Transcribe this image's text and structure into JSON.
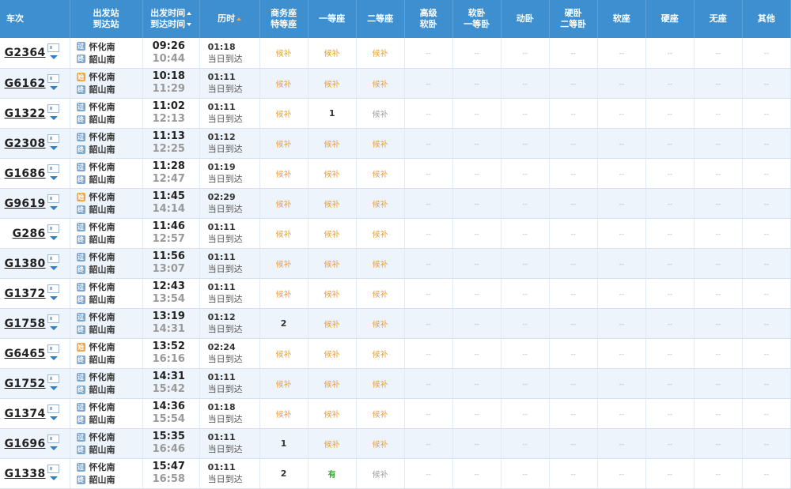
{
  "headers": {
    "train": "车次",
    "station_from": "出发站",
    "station_to": "到达站",
    "depart_time": "出发时间",
    "arrive_time": "到达时间",
    "duration": "历时",
    "business_1": "商务座",
    "business_2": "特等座",
    "first": "一等座",
    "second": "二等座",
    "soft_sleeper_1": "高级",
    "soft_sleeper_2": "软卧",
    "soft_first_1": "软卧",
    "soft_first_2": "一等卧",
    "moving_sleeper": "动卧",
    "hard_second_1": "硬卧",
    "hard_second_2": "二等卧",
    "soft_seat": "软座",
    "hard_seat": "硬座",
    "no_seat": "无座",
    "other": "其他"
  },
  "empty": "--",
  "station_badge_text": {
    "pass": "过",
    "start": "始",
    "end": "终"
  },
  "rows": [
    {
      "train": "G2364",
      "from": "怀化南",
      "from_type": "pass",
      "to": "韶山南",
      "depart": "09:26",
      "arrive": "10:44",
      "duration": "01:18",
      "arrival_day": "当日到达",
      "business": "候补",
      "first": "候补",
      "second": "候补"
    },
    {
      "train": "G6162",
      "from": "怀化南",
      "from_type": "start",
      "to": "韶山南",
      "depart": "10:18",
      "arrive": "11:29",
      "duration": "01:11",
      "arrival_day": "当日到达",
      "business": "候补",
      "first": "候补",
      "second": "候补"
    },
    {
      "train": "G1322",
      "from": "怀化南",
      "from_type": "pass",
      "to": "韶山南",
      "depart": "11:02",
      "arrive": "12:13",
      "duration": "01:11",
      "arrival_day": "当日到达",
      "business": "候补",
      "first": "1",
      "second": "候补"
    },
    {
      "train": "G2308",
      "from": "怀化南",
      "from_type": "pass",
      "to": "韶山南",
      "depart": "11:13",
      "arrive": "12:25",
      "duration": "01:12",
      "arrival_day": "当日到达",
      "business": "候补",
      "first": "候补",
      "second": "候补"
    },
    {
      "train": "G1686",
      "from": "怀化南",
      "from_type": "pass",
      "to": "韶山南",
      "depart": "11:28",
      "arrive": "12:47",
      "duration": "01:19",
      "arrival_day": "当日到达",
      "business": "候补",
      "first": "候补",
      "second": "候补"
    },
    {
      "train": "G9619",
      "from": "怀化南",
      "from_type": "start",
      "to": "韶山南",
      "depart": "11:45",
      "arrive": "14:14",
      "duration": "02:29",
      "arrival_day": "当日到达",
      "business": "候补",
      "first": "候补",
      "second": "候补"
    },
    {
      "train": "G286",
      "from": "怀化南",
      "from_type": "pass",
      "to": "韶山南",
      "depart": "11:46",
      "arrive": "12:57",
      "duration": "01:11",
      "arrival_day": "当日到达",
      "business": "候补",
      "first": "候补",
      "second": "候补"
    },
    {
      "train": "G1380",
      "from": "怀化南",
      "from_type": "pass",
      "to": "韶山南",
      "depart": "11:56",
      "arrive": "13:07",
      "duration": "01:11",
      "arrival_day": "当日到达",
      "business": "候补",
      "first": "候补",
      "second": "候补"
    },
    {
      "train": "G1372",
      "from": "怀化南",
      "from_type": "pass",
      "to": "韶山南",
      "depart": "12:43",
      "arrive": "13:54",
      "duration": "01:11",
      "arrival_day": "当日到达",
      "business": "候补",
      "first": "候补",
      "second": "候补"
    },
    {
      "train": "G1758",
      "from": "怀化南",
      "from_type": "pass",
      "to": "韶山南",
      "depart": "13:19",
      "arrive": "14:31",
      "duration": "01:12",
      "arrival_day": "当日到达",
      "business": "2",
      "first": "候补",
      "second": "候补"
    },
    {
      "train": "G6465",
      "from": "怀化南",
      "from_type": "start",
      "to": "韶山南",
      "depart": "13:52",
      "arrive": "16:16",
      "duration": "02:24",
      "arrival_day": "当日到达",
      "business": "候补",
      "first": "候补",
      "second": "候补"
    },
    {
      "train": "G1752",
      "from": "怀化南",
      "from_type": "pass",
      "to": "韶山南",
      "depart": "14:31",
      "arrive": "15:42",
      "duration": "01:11",
      "arrival_day": "当日到达",
      "business": "候补",
      "first": "候补",
      "second": "候补"
    },
    {
      "train": "G1374",
      "from": "怀化南",
      "from_type": "pass",
      "to": "韶山南",
      "depart": "14:36",
      "arrive": "15:54",
      "duration": "01:18",
      "arrival_day": "当日到达",
      "business": "候补",
      "first": "候补",
      "second": "候补"
    },
    {
      "train": "G1696",
      "from": "怀化南",
      "from_type": "pass",
      "to": "韶山南",
      "depart": "15:35",
      "arrive": "16:46",
      "duration": "01:11",
      "arrival_day": "当日到达",
      "business": "1",
      "first": "候补",
      "second": "候补"
    },
    {
      "train": "G1338",
      "from": "怀化南",
      "from_type": "pass",
      "to": "韶山南",
      "depart": "15:47",
      "arrive": "16:58",
      "duration": "01:11",
      "arrival_day": "当日到达",
      "business": "2",
      "first": "有",
      "second": "候补"
    }
  ]
}
